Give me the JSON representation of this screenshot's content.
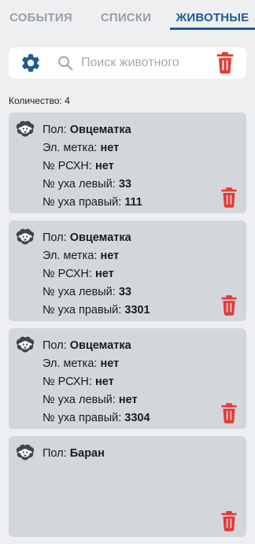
{
  "tabs": [
    {
      "label": "СОБЫТИЯ",
      "active": false
    },
    {
      "label": "СПИСКИ",
      "active": false
    },
    {
      "label": "ЖИВОТНЫЕ",
      "active": true
    }
  ],
  "colors": {
    "accent": "#1e5b97",
    "delete": "#e53935",
    "card_bg": "#d3d6da",
    "background": "#eeeff1"
  },
  "search": {
    "placeholder": "Поиск животного",
    "value": "",
    "settings_icon": "gear-icon",
    "search_icon": "search-icon",
    "delete_icon": "trash-icon"
  },
  "count": {
    "label": "Количество:",
    "value": "4"
  },
  "field_labels": {
    "sex": "Пол:",
    "eid": "Эл. метка:",
    "rshn": "№ РСХН:",
    "ear_left": "№ уха левый:",
    "ear_right": "№ уха правый:"
  },
  "animals": [
    {
      "sex": "Овцематка",
      "eid": "нет",
      "rshn": "нет",
      "ear_left": "33",
      "ear_right": "111"
    },
    {
      "sex": "Овцематка",
      "eid": "нет",
      "rshn": "нет",
      "ear_left": "33",
      "ear_right": "3301"
    },
    {
      "sex": "Овцематка",
      "eid": "нет",
      "rshn": "нет",
      "ear_left": "нет",
      "ear_right": "3304"
    },
    {
      "sex": "Баран",
      "eid": "",
      "rshn": "",
      "ear_left": "",
      "ear_right": ""
    }
  ]
}
